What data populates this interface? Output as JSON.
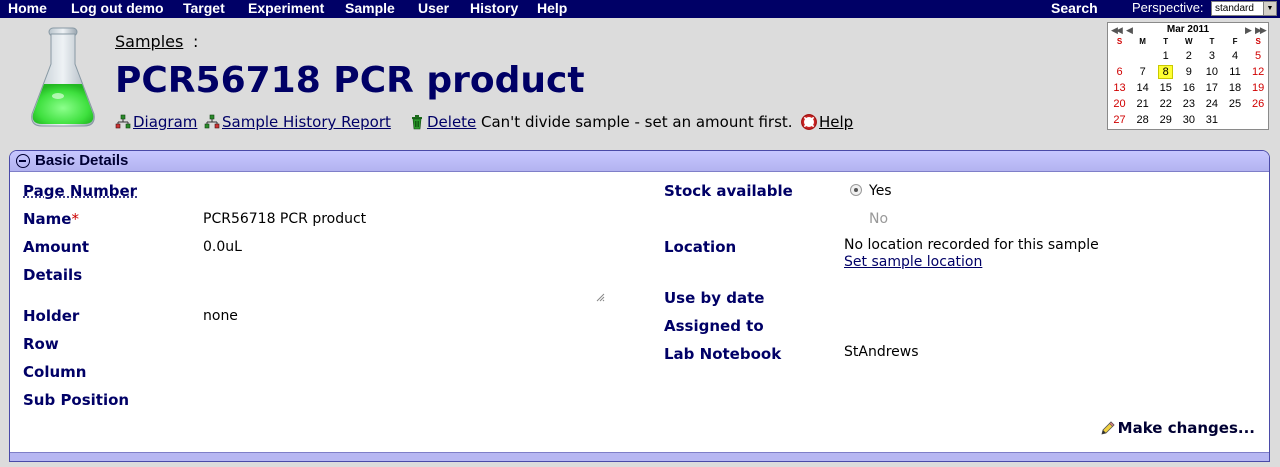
{
  "nav": {
    "items": [
      "Home",
      "Log out demo",
      "Target",
      "Experiment",
      "Sample",
      "User",
      "History",
      "Help"
    ],
    "search": "Search",
    "perspective_label": "Perspective:",
    "perspective_value": "standard"
  },
  "header": {
    "breadcrumb": "Samples",
    "breadcrumb_sep": ":",
    "title": "PCR56718 PCR product",
    "actions": {
      "diagram": "Diagram",
      "history_report": "Sample History Report",
      "delete": "Delete",
      "message": "Can't divide sample - set an amount first.",
      "help": "Help"
    }
  },
  "calendar": {
    "title": "Mar 2011",
    "days_of_week": [
      "S",
      "M",
      "T",
      "W",
      "T",
      "F",
      "S"
    ],
    "weeks": [
      [
        "",
        "",
        "1",
        "2",
        "3",
        "4",
        "5"
      ],
      [
        "6",
        "7",
        "8",
        "9",
        "10",
        "11",
        "12"
      ],
      [
        "13",
        "14",
        "15",
        "16",
        "17",
        "18",
        "19"
      ],
      [
        "20",
        "21",
        "22",
        "23",
        "24",
        "25",
        "26"
      ],
      [
        "27",
        "28",
        "29",
        "30",
        "31",
        "",
        ""
      ]
    ],
    "today": "8"
  },
  "panel": {
    "title": "Basic Details",
    "left": {
      "page_number_label": "Page Number",
      "name_label": "Name",
      "required_mark": "*",
      "name_value": "PCR56718 PCR product",
      "amount_label": "Amount",
      "amount_value": "0.0uL",
      "details_label": "Details",
      "holder_label": "Holder",
      "holder_value": "none",
      "row_label": "Row",
      "column_label": "Column",
      "sub_position_label": "Sub Position"
    },
    "right": {
      "stock_label": "Stock available",
      "stock_yes": "Yes",
      "stock_no": "No",
      "location_label": "Location",
      "location_value": "No location recorded for this sample",
      "set_location": "Set sample location",
      "use_by_label": "Use by date",
      "assigned_label": "Assigned to",
      "notebook_label": "Lab Notebook",
      "notebook_value": "StAndrews"
    },
    "make_changes": "Make changes..."
  },
  "colors": {
    "nav_bg": "#000066",
    "label": "#000066",
    "panel_header": "#c0c0ff",
    "required": "#cc0000",
    "today_highlight": "#ffff33"
  }
}
